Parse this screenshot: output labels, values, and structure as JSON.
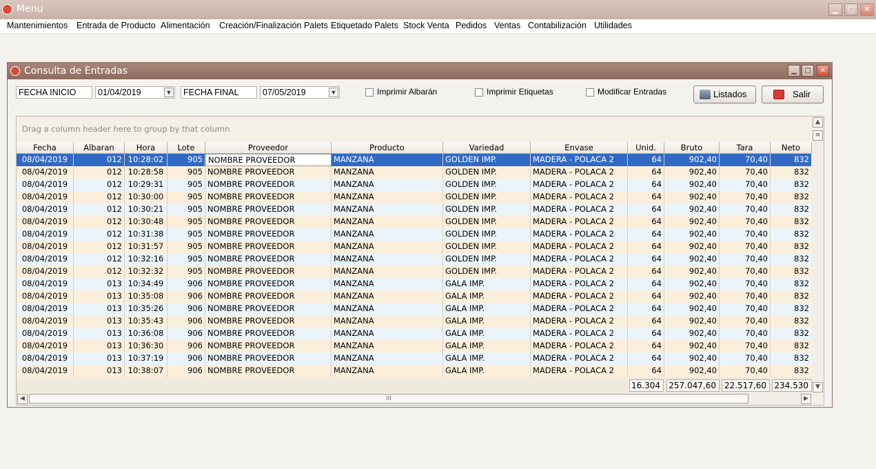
{
  "window": {
    "title": "Menu",
    "min_glyph": "▁",
    "max_glyph": "□",
    "close_glyph": "✕"
  },
  "menu": [
    {
      "label": "Mantenimientos"
    },
    {
      "label": "Entrada de Producto"
    },
    {
      "label": "Alimentación"
    },
    {
      "label": "Creación/Finalización Palets"
    },
    {
      "label": "Etiquetado Palets"
    },
    {
      "label": "Stock Venta"
    },
    {
      "label": "Pedidos"
    },
    {
      "label": "Ventas"
    },
    {
      "label": "Contabilización"
    },
    {
      "label": "Utilidades"
    }
  ],
  "child": {
    "title": "Consulta de Entradas",
    "fecha_inicio_label": "FECHA INICIO",
    "fecha_inicio": "01/04/2019",
    "fecha_final_label": "FECHA FINAL",
    "fecha_final": "07/05/2019",
    "chk_albaran": "Imprimir Albarán",
    "chk_etiquetas": "Imprimir Etiquetas",
    "chk_modificar": "Modificar Entradas",
    "listados_label": "Listados",
    "salir_label": "Salir"
  },
  "grid": {
    "group_panel_text": "Drag a column header here to group by that column",
    "columns": [
      "Fecha",
      "Albaran",
      "Hora",
      "Lote",
      "Proveedor",
      "Producto",
      "Variedad",
      "Envase",
      "Unid.",
      "Bruto",
      "Tara",
      "Neto"
    ],
    "rows": [
      [
        "08/04/2019",
        "012",
        "10:28:02",
        "905",
        "NOMBRE PROVEEDOR",
        "MANZANA",
        "GOLDEN IMP.",
        "MADERA - POLACA 2",
        "64",
        "902,40",
        "70,40",
        "832"
      ],
      [
        "08/04/2019",
        "012",
        "10:28:58",
        "905",
        "NOMBRE PROVEEDOR",
        "MANZANA",
        "GOLDEN IMP.",
        "MADERA - POLACA 2",
        "64",
        "902,40",
        "70,40",
        "832"
      ],
      [
        "08/04/2019",
        "012",
        "10:29:31",
        "905",
        "NOMBRE PROVEEDOR",
        "MANZANA",
        "GOLDEN IMP.",
        "MADERA - POLACA 2",
        "64",
        "902,40",
        "70,40",
        "832"
      ],
      [
        "08/04/2019",
        "012",
        "10:30:00",
        "905",
        "NOMBRE PROVEEDOR",
        "MANZANA",
        "GOLDEN IMP.",
        "MADERA - POLACA 2",
        "64",
        "902,40",
        "70,40",
        "832"
      ],
      [
        "08/04/2019",
        "012",
        "10:30:21",
        "905",
        "NOMBRE PROVEEDOR",
        "MANZANA",
        "GOLDEN IMP.",
        "MADERA - POLACA 2",
        "64",
        "902,40",
        "70,40",
        "832"
      ],
      [
        "08/04/2019",
        "012",
        "10:30:48",
        "905",
        "NOMBRE PROVEEDOR",
        "MANZANA",
        "GOLDEN IMP.",
        "MADERA - POLACA 2",
        "64",
        "902,40",
        "70,40",
        "832"
      ],
      [
        "08/04/2019",
        "012",
        "10:31:38",
        "905",
        "NOMBRE PROVEEDOR",
        "MANZANA",
        "GOLDEN IMP.",
        "MADERA - POLACA 2",
        "64",
        "902,40",
        "70,40",
        "832"
      ],
      [
        "08/04/2019",
        "012",
        "10:31:57",
        "905",
        "NOMBRE PROVEEDOR",
        "MANZANA",
        "GOLDEN IMP.",
        "MADERA - POLACA 2",
        "64",
        "902,40",
        "70,40",
        "832"
      ],
      [
        "08/04/2019",
        "012",
        "10:32:16",
        "905",
        "NOMBRE PROVEEDOR",
        "MANZANA",
        "GOLDEN IMP.",
        "MADERA - POLACA 2",
        "64",
        "902,40",
        "70,40",
        "832"
      ],
      [
        "08/04/2019",
        "012",
        "10:32:32",
        "905",
        "NOMBRE PROVEEDOR",
        "MANZANA",
        "GOLDEN IMP.",
        "MADERA - POLACA 2",
        "64",
        "902,40",
        "70,40",
        "832"
      ],
      [
        "08/04/2019",
        "013",
        "10:34:49",
        "906",
        "NOMBRE PROVEEDOR",
        "MANZANA",
        "GALA IMP.",
        "MADERA - POLACA 2",
        "64",
        "902,40",
        "70,40",
        "832"
      ],
      [
        "08/04/2019",
        "013",
        "10:35:08",
        "906",
        "NOMBRE PROVEEDOR",
        "MANZANA",
        "GALA IMP.",
        "MADERA - POLACA 2",
        "64",
        "902,40",
        "70,40",
        "832"
      ],
      [
        "08/04/2019",
        "013",
        "10:35:26",
        "906",
        "NOMBRE PROVEEDOR",
        "MANZANA",
        "GALA IMP.",
        "MADERA - POLACA 2",
        "64",
        "902,40",
        "70,40",
        "832"
      ],
      [
        "08/04/2019",
        "013",
        "10:35:43",
        "906",
        "NOMBRE PROVEEDOR",
        "MANZANA",
        "GALA IMP.",
        "MADERA - POLACA 2",
        "64",
        "902,40",
        "70,40",
        "832"
      ],
      [
        "08/04/2019",
        "013",
        "10:36:08",
        "906",
        "NOMBRE PROVEEDOR",
        "MANZANA",
        "GALA IMP.",
        "MADERA - POLACA 2",
        "64",
        "902,40",
        "70,40",
        "832"
      ],
      [
        "08/04/2019",
        "013",
        "10:36:30",
        "906",
        "NOMBRE PROVEEDOR",
        "MANZANA",
        "GALA IMP.",
        "MADERA - POLACA 2",
        "64",
        "902,40",
        "70,40",
        "832"
      ],
      [
        "08/04/2019",
        "013",
        "10:37:19",
        "906",
        "NOMBRE PROVEEDOR",
        "MANZANA",
        "GALA IMP.",
        "MADERA - POLACA 2",
        "64",
        "902,40",
        "70,40",
        "832"
      ],
      [
        "08/04/2019",
        "013",
        "10:38:07",
        "906",
        "NOMBRE PROVEEDOR",
        "MANZANA",
        "GALA IMP.",
        "MADERA - POLACA 2",
        "64",
        "902,40",
        "70,40",
        "832"
      ]
    ],
    "totals": [
      "16.304",
      "257.047,60",
      "22.517,60",
      "234.530"
    ],
    "hscroll_thumb_glyph": "III"
  },
  "colors": {
    "selected_row": "#316ac5",
    "row_even": "#eaf4fa",
    "row_odd": "#fbefdc"
  },
  "icons": {
    "listados": "printer-icon",
    "salir": "exit-icon"
  }
}
